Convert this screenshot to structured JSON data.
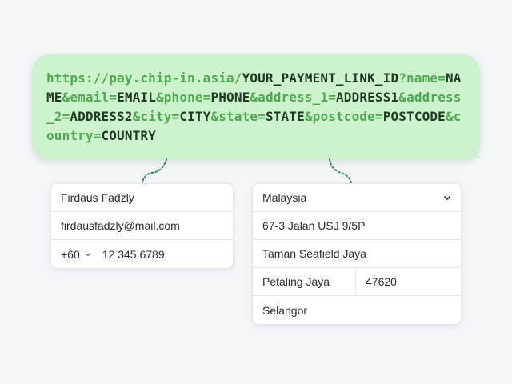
{
  "url": {
    "parts": [
      {
        "text": "https://pay.chip-in.asia/",
        "kind": "c"
      },
      {
        "text": "YOUR_PAYMENT_LINK_ID",
        "kind": "v"
      },
      {
        "text": "?name=",
        "kind": "c"
      },
      {
        "text": "NAME",
        "kind": "v"
      },
      {
        "text": "&email=",
        "kind": "c"
      },
      {
        "text": "EMAIL",
        "kind": "v"
      },
      {
        "text": "&phone=",
        "kind": "c"
      },
      {
        "text": "PHONE",
        "kind": "v"
      },
      {
        "text": "&address_1=",
        "kind": "c"
      },
      {
        "text": "ADDRESS1",
        "kind": "v"
      },
      {
        "text": "&address_2=",
        "kind": "c"
      },
      {
        "text": "ADDRESS2",
        "kind": "v"
      },
      {
        "text": "&city=",
        "kind": "c"
      },
      {
        "text": "CITY",
        "kind": "v"
      },
      {
        "text": "&state=",
        "kind": "c"
      },
      {
        "text": "STATE",
        "kind": "v"
      },
      {
        "text": "&postcode=",
        "kind": "c"
      },
      {
        "text": "POSTCODE",
        "kind": "v"
      },
      {
        "text": "&country=",
        "kind": "c"
      },
      {
        "text": "COUNTRY",
        "kind": "v"
      }
    ]
  },
  "contact_form": {
    "name": "Firdaus Fadzly",
    "email": "firdausfadzly@mail.com",
    "phone_code": "+60",
    "phone_number": "12 345 6789"
  },
  "address_form": {
    "country": "Malaysia",
    "address_1": "67-3 Jalan USJ 9/5P",
    "address_2": "Taman Seafield Jaya",
    "city": "Petaling Jaya",
    "postcode": "47620",
    "state": "Selangor"
  },
  "icons": {
    "phone_code_dropdown": "chevron-down-icon",
    "country_dropdown": "chevron-down-icon"
  },
  "colors": {
    "bubble_bg": "#cdf3cd",
    "url_constant": "#4da94d",
    "url_variable": "#1f3a23",
    "connector": "#3d8a55"
  }
}
